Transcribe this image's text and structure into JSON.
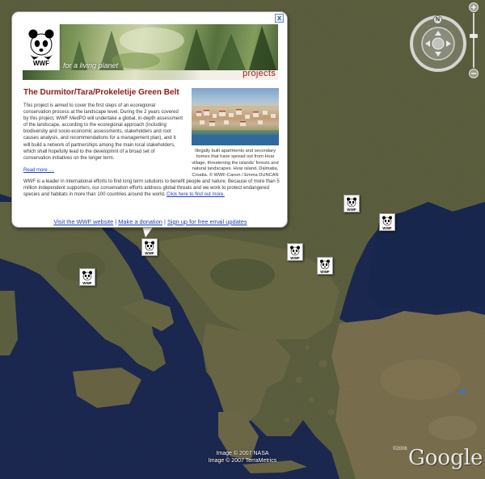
{
  "balloon": {
    "close_label": "x",
    "banner": {
      "logo_text": "WWF",
      "tagline": "for a living planet",
      "projects_label": "projects"
    },
    "title": "The Durmitor/Tara/Prokeletije Green Belt",
    "body": "This project is aimed to cover the first steps of an ecoregional conservation process at the landscape level. During the 2 years covered by this project, WWF MedPO will undertake a global, in-depth assessment of the landscape, according to the ecoregional approach (including biodiversity and socio-economic assessments, stakeholders and root causes analysis, and recommendations for a management plan), and it will build a network of partnerships among the main local stakeholders, which shall hopefully lead to the developmnt of a broad set of conservation initiatives on the longer term.",
    "read_more": "Read more ....",
    "photo_caption": "Illegally built apartments and secondary homes that have spread out from Hvar village, threatening the islands' forests and natural landscapes. Hvar island, Dalmatia, Croatia. © WWF-Canon / Emma DUNCAN",
    "statement": "WWF is a leader in international efforts to find long term solutions to benefit people and nature. Because of more than 5 million independent supporters, our conservation efforts address global threats and we work to protect endangered species and habitats in more than 100 countries around the world.",
    "statement_link": "Click here to find out more.",
    "footer": {
      "visit": "Visit the WWF website",
      "sep1": "|",
      "donate": "Make a donation",
      "sep2": "|",
      "signup": "Sign up for free email updates"
    }
  },
  "markers": [
    {
      "label": "WWF"
    },
    {
      "label": "WWF"
    },
    {
      "label": "WWF"
    },
    {
      "label": "WWF"
    },
    {
      "label": "WWF"
    },
    {
      "label": "WWF"
    }
  ],
  "navigation": {
    "north_label": "N"
  },
  "attribution": {
    "line1": "Image © 2007 NASA",
    "line2": "Image © 2007 TerraMetrics",
    "copyright": "©2006",
    "logo": "Google"
  },
  "colors": {
    "title": "#8b1c14",
    "link": "#1a3fb8",
    "sea": "#1b2a52",
    "land": "#6b6a48"
  }
}
